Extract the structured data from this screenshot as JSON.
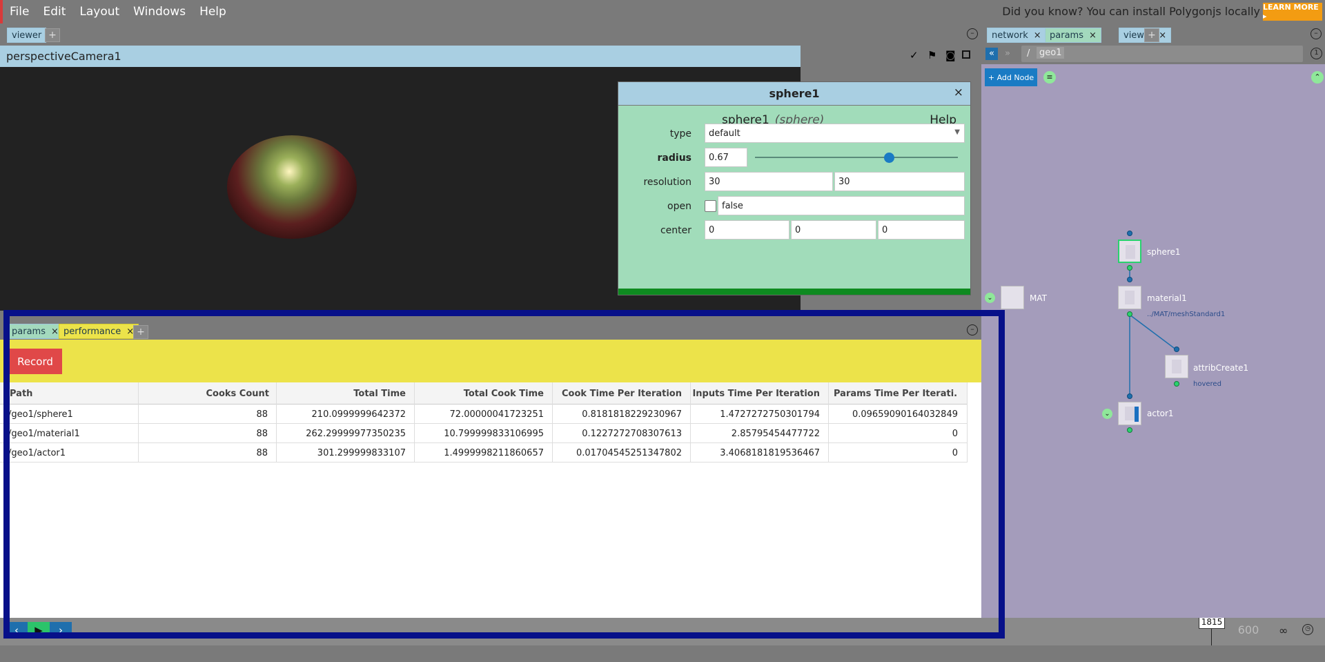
{
  "menubar": {
    "items": [
      "File",
      "Edit",
      "Layout",
      "Windows",
      "Help"
    ],
    "tip": "Did you know? You can install Polygonjs locally",
    "learn_more": "LEARN MORE ▸"
  },
  "viewer": {
    "tab": "viewer",
    "add": "+",
    "camera": "perspectiveCamera1"
  },
  "params": {
    "title": "sphere1",
    "close": "×",
    "node_name": "sphere1",
    "node_type": "(sphere)",
    "help": "Help",
    "rows": {
      "type_label": "type",
      "type_value": "default",
      "radius_label": "radius",
      "radius_value": "0.67",
      "radius_fraction": 0.67,
      "resolution_label": "resolution",
      "resolution_x": "30",
      "resolution_y": "30",
      "open_label": "open",
      "open_value": "false",
      "center_label": "center",
      "center_x": "0",
      "center_y": "0",
      "center_z": "0"
    }
  },
  "performance": {
    "tabs": [
      {
        "label": "params",
        "close": "×"
      },
      {
        "label": "performance",
        "close": "×"
      }
    ],
    "add": "+",
    "record": "Record",
    "columns": [
      "Path",
      "Cooks Count",
      "Total Time",
      "Total Cook Time",
      "Cook Time Per Iteration",
      "Inputs Time Per Iteration",
      "Params Time Per Iterati..."
    ],
    "rows": [
      [
        "/geo1/sphere1",
        "88",
        "210.0999999642372",
        "72.00000041723251",
        "0.8181818229230967",
        "1.4727272750301794",
        "0.09659090164032849"
      ],
      [
        "/geo1/material1",
        "88",
        "262.29999977350235",
        "10.799999833106995",
        "0.1227272708307613",
        "2.85795454477722",
        "0"
      ],
      [
        "/geo1/actor1",
        "88",
        "301.299999833107",
        "1.4999998211860657",
        "0.01704545251347802",
        "3.4068181819536467",
        "0"
      ]
    ]
  },
  "timeline": {
    "frame": "1815",
    "end_frame": "600"
  },
  "network": {
    "tabs": [
      {
        "label": "network",
        "close": "×"
      },
      {
        "label": "params",
        "close": "×"
      },
      {
        "label": "viewer",
        "close": "×"
      }
    ],
    "add": "+",
    "path_sep": "/",
    "path": "geo1",
    "counter": "1",
    "add_node": "+ Add Node",
    "nodes": {
      "sphere": "sphere1",
      "mat": "MAT",
      "material": "material1",
      "material_sub": "../MAT/meshStandard1",
      "attrib": "attribCreate1",
      "attrib_sub": "hovered",
      "actor": "actor1"
    }
  },
  "colors": {
    "accent_blue": "#a9cfe2",
    "panel_green": "#a1dcba",
    "perf_yellow": "#ece34a",
    "record_red": "#e04848",
    "network_bg": "#a49cbb",
    "selection": "#071089"
  }
}
